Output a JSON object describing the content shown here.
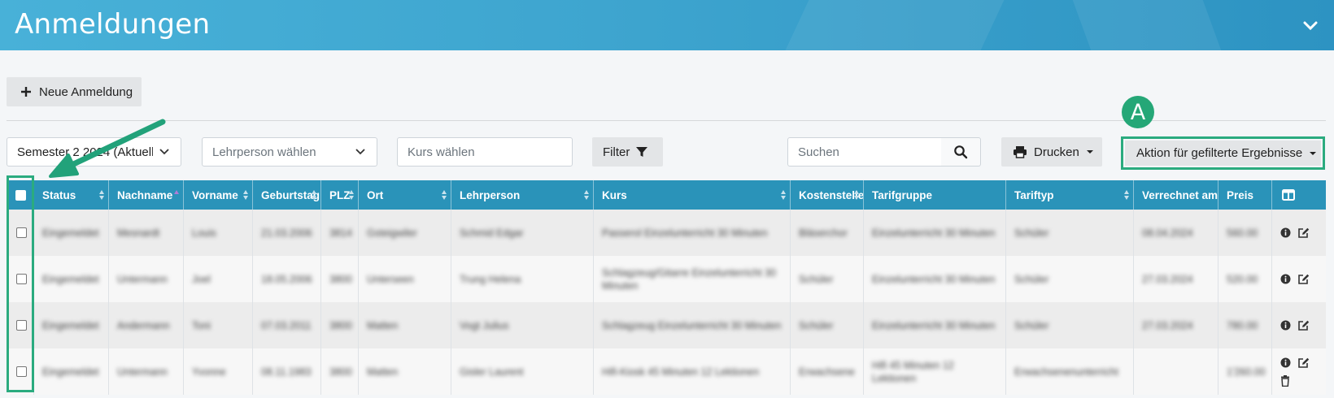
{
  "header": {
    "title": "Anmeldungen"
  },
  "toolbar": {
    "new_label": "Neue Anmeldung",
    "semester": "Semester 2 2024 (Aktuell)",
    "teacher_placeholder": "Lehrperson wählen",
    "course_placeholder": "Kurs wählen",
    "filter_label": "Filter",
    "search_placeholder": "Suchen",
    "print_label": "Drucken",
    "action_label": "Aktion für gefilterte Ergebnisse",
    "badge": "A"
  },
  "table": {
    "columns": [
      "Status",
      "Nachname",
      "Vorname",
      "Geburtstag",
      "PLZ",
      "Ort",
      "Lehrperson",
      "Kurs",
      "Kostenstelle",
      "Tarifgruppe",
      "Tariftyp",
      "Verrechnet am",
      "Preis"
    ],
    "rows": [
      [
        "Eingemeldet",
        "Mesnardt",
        "Louis",
        "21.03.2006",
        "3814",
        "Gsteigwiler",
        "Schmid Edgar",
        "Passerol Einzelunterricht 30 Minuten",
        "Bläserchor",
        "Einzelunterricht 30 Minuten",
        "Schüler",
        "08.04.2024",
        "560.00"
      ],
      [
        "Eingemeldet",
        "Untermann",
        "Joel",
        "18.05.2006",
        "3800",
        "Unterseen",
        "Trung Helena",
        "Schlagzeug/Gitarre Einzelunterricht 30 Minuten",
        "Schüler",
        "Einzelunterricht 30 Minuten",
        "Schüler",
        "27.03.2024",
        "520.00"
      ],
      [
        "Eingemeldet",
        "Andermann",
        "Toni",
        "07.03.2011",
        "3800",
        "Matten",
        "Vogt Julius",
        "Schlagzeug Einzelunterricht 30 Minuten",
        "Schüler",
        "Einzelunterricht 30 Minuten",
        "Schüler",
        "27.03.2024",
        "780.00"
      ],
      [
        "Eingemeldet",
        "Untermann",
        "Yvonne",
        "08.11.1983",
        "3800",
        "Matten",
        "Gisler Laurent",
        "Hifi-Kiosk 45 Minuten 12 Lektionen",
        "Erwachsene",
        "Hifi 45 Minuten 12 Lektionen",
        "Erwachsenenunterricht",
        "",
        "1'260.00"
      ]
    ]
  },
  "colors": {
    "header": "#3ea5cf",
    "table_head": "#2a93b9",
    "highlight": "#2bab7f"
  }
}
